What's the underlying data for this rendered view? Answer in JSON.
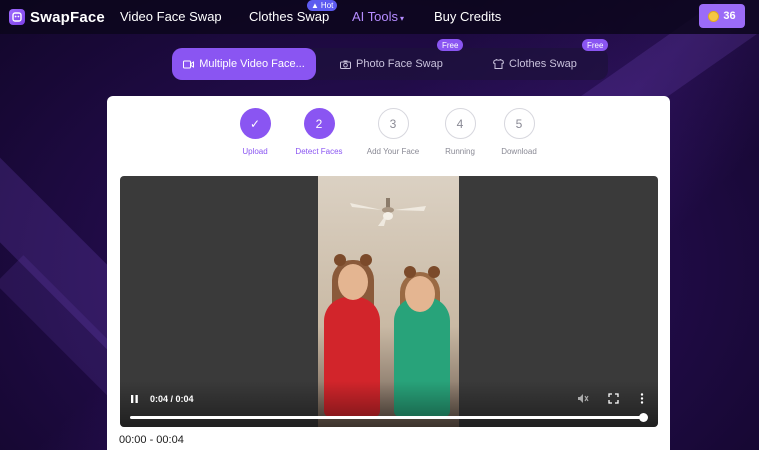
{
  "brand": {
    "name": "SwapFace"
  },
  "nav": {
    "items": [
      {
        "label": "Video Face Swap"
      },
      {
        "label": "Clothes Swap",
        "badge": "Hot"
      },
      {
        "label": "AI Tools"
      },
      {
        "label": "Buy Credits"
      }
    ],
    "credits": "36"
  },
  "modes": [
    {
      "label": "Multiple Video Face...",
      "active": true
    },
    {
      "label": "Photo Face Swap",
      "badge": "Free"
    },
    {
      "label": "Clothes Swap",
      "badge": "Free"
    }
  ],
  "steps": [
    {
      "number": "✓",
      "label": "Upload",
      "state": "done"
    },
    {
      "number": "2",
      "label": "Detect Faces",
      "state": "done"
    },
    {
      "number": "3",
      "label": "Add Your Face",
      "state": "todo"
    },
    {
      "number": "4",
      "label": "Running",
      "state": "todo"
    },
    {
      "number": "5",
      "label": "Download",
      "state": "todo"
    }
  ],
  "video": {
    "time": "0:04 / 0:04",
    "progress": 1.0,
    "range": "00:00 - 00:04"
  },
  "colors": {
    "accent": "#8a55f2",
    "badge_hot": "#5d5bf0",
    "coin": "#f6c744"
  },
  "icons": [
    "pause-icon",
    "mute-icon",
    "fullscreen-icon",
    "more-icon",
    "video-icon",
    "camera-icon",
    "shirt-icon",
    "coin-icon",
    "check-icon"
  ]
}
